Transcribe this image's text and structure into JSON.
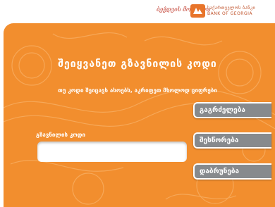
{
  "header": {
    "slogan": "ბეჭდვის მოსპულა",
    "bank_name_ka": "საქართველოს ბანკი",
    "bank_name_en": "BANK OF GEORGIA"
  },
  "pin_screen": {
    "title": "შეიყვანეთ გზავნილის კოდი",
    "subtitle": "თუ კოდი შეიცავს ასოებს, აკრიფეთ მხოლოდ ციფრები",
    "field_label": "გზავნილის კოდი",
    "field_value": ""
  },
  "buttons": {
    "continue_label": "გაგრძელება",
    "correct_label": "შესწორება",
    "back_label": "დაბრუნება"
  },
  "colors": {
    "panel": "#f28e2e",
    "button": "#878a8d",
    "brand_red": "#c0392b"
  }
}
